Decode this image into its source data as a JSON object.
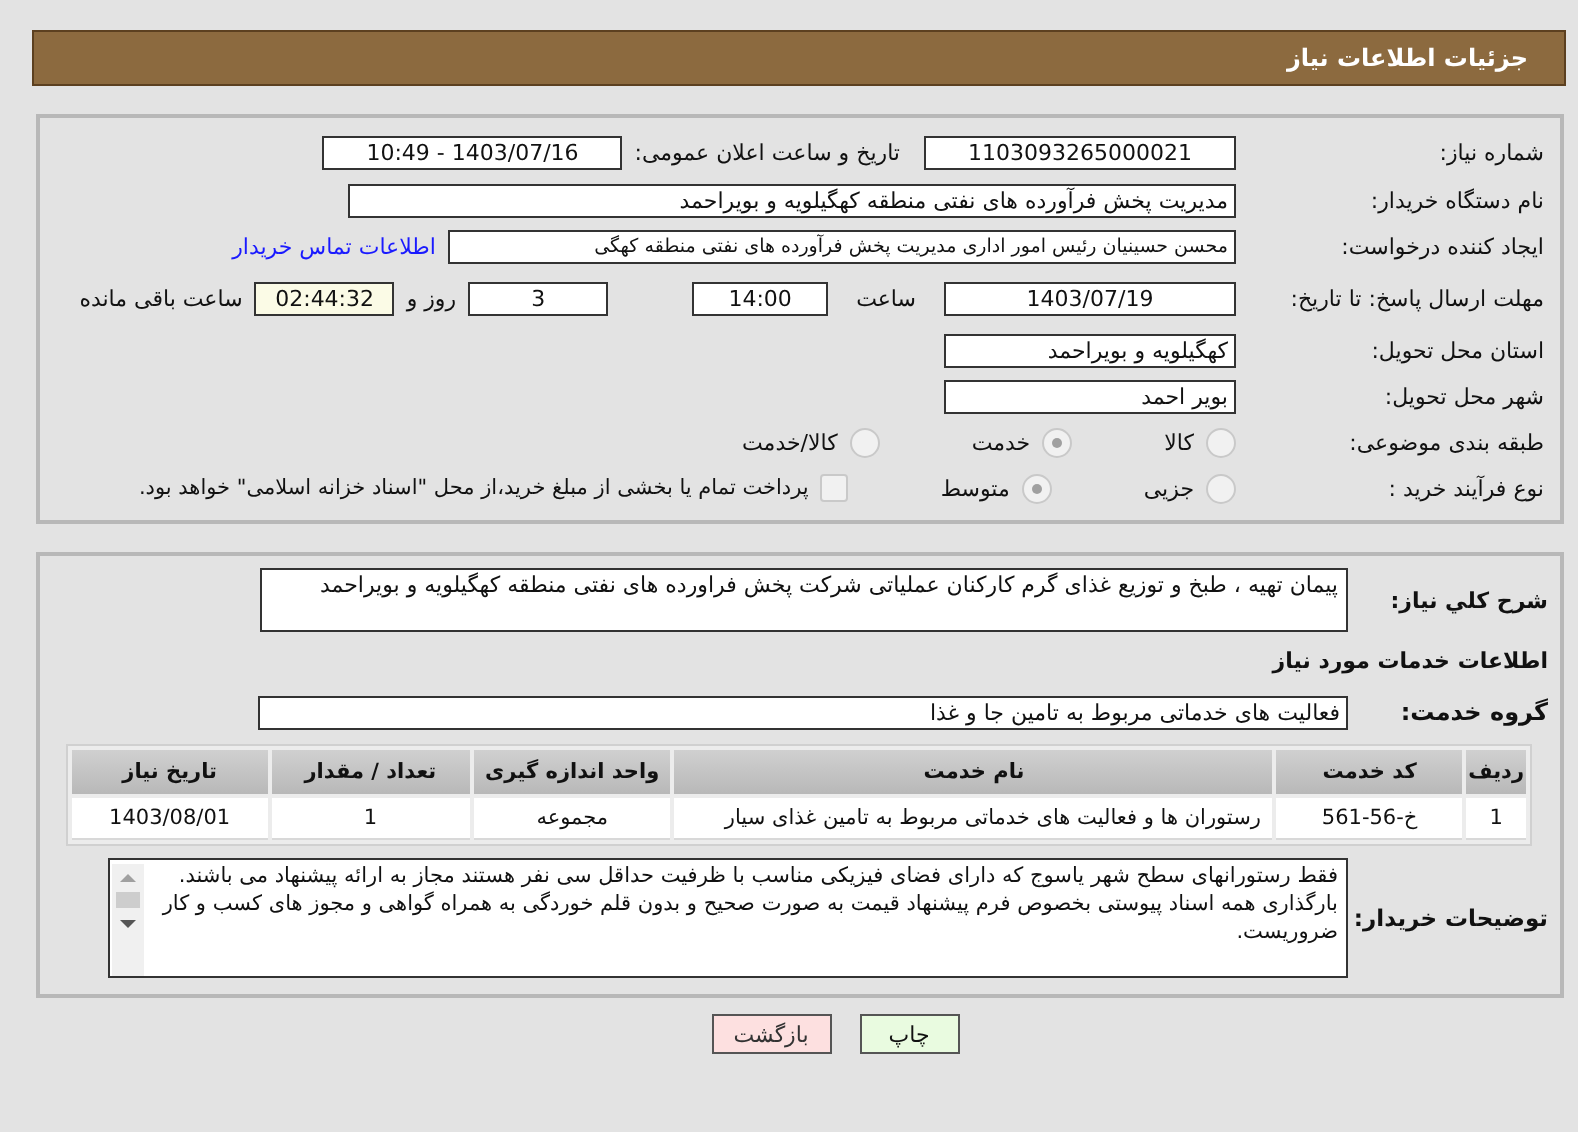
{
  "header": {
    "title": "جزئیات اطلاعات نیاز"
  },
  "info": {
    "need_number": {
      "label": "شماره نیاز:",
      "value": "1103093265000021"
    },
    "announce": {
      "label": "تاریخ و ساعت اعلان عمومی:",
      "value": "1403/07/16 - 10:49"
    },
    "buyer": {
      "label": "نام دستگاه خریدار:",
      "value": "مدیریت پخش فرآورده های نفتی منطقه کهگیلویه و بویراحمد"
    },
    "requester": {
      "label": "ایجاد کننده درخواست:",
      "value": "محسن حسینیان رئیس امور اداری مدیریت پخش فرآورده های نفتی منطقه کهگی",
      "link": "اطلاعات تماس خریدار"
    },
    "deadline": {
      "label": "مهلت ارسال پاسخ: تا تاریخ:",
      "date": "1403/07/19",
      "time_label": "ساعت",
      "time": "14:00",
      "days": "3",
      "days_label": "روز و",
      "remaining": "02:44:32",
      "remaining_label": "ساعت باقی مانده"
    },
    "province": {
      "label": "استان محل تحویل:",
      "value": "کهگیلویه و بویراحمد"
    },
    "city": {
      "label": "شهر محل تحویل:",
      "value": "بویر احمد"
    },
    "category": {
      "label": "طبقه بندی موضوعی:",
      "options": [
        {
          "label": "کالا",
          "selected": false
        },
        {
          "label": "خدمت",
          "selected": true
        },
        {
          "label": "کالا/خدمت",
          "selected": false
        }
      ]
    },
    "process": {
      "label": "نوع فرآیند خرید :",
      "options": [
        {
          "label": "جزیی",
          "selected": false
        },
        {
          "label": "متوسط",
          "selected": true
        }
      ],
      "payment": {
        "checked": false,
        "text": "پرداخت تمام یا بخشی از مبلغ خرید،از محل \"اسناد خزانه اسلامی\" خواهد بود."
      }
    }
  },
  "details": {
    "summary": {
      "label": "شرح کلي نیاز:",
      "value": "پیمان تهیه ، طبخ و توزیع غذای گرم کارکنان عملیاتی شرکت پخش فراورده های نفتی منطقه کهگیلویه و بویراحمد"
    },
    "services_heading": "اطلاعات خدمات مورد نیاز",
    "group": {
      "label": "گروه خدمت:",
      "value": "فعالیت های خدماتی مربوط به تامین جا و غذا"
    },
    "table": {
      "columns": [
        "ردیف",
        "کد خدمت",
        "نام خدمت",
        "واحد اندازه گیری",
        "تعداد / مقدار",
        "تاریخ نیاز"
      ],
      "rows": [
        [
          "1",
          "خ-56-561",
          "رستوران ها و فعالیت های خدماتی مربوط به تامین غذای سیار",
          "مجموعه",
          "1",
          "1403/08/01"
        ]
      ]
    },
    "notes": {
      "label": "توضیحات خریدار:",
      "paragraphs": [
        "فقط رستورانهای سطح شهر یاسوج که دارای  فضای فیزیکی  مناسب با ظرفیت حداقل سی نفر هستند مجاز به ارائه پیشنهاد می باشند.",
        "بارگذاری همه اسناد پیوستی بخصوص فرم پیشنهاد قیمت به صورت صحیح و بدون قلم خوردگی به همراه گواهی و مجوز های کسب و کار ضروریست."
      ]
    }
  },
  "buttons": [
    {
      "label": "چاپ",
      "kind": "print"
    },
    {
      "label": "بازگشت",
      "kind": "back"
    }
  ]
}
